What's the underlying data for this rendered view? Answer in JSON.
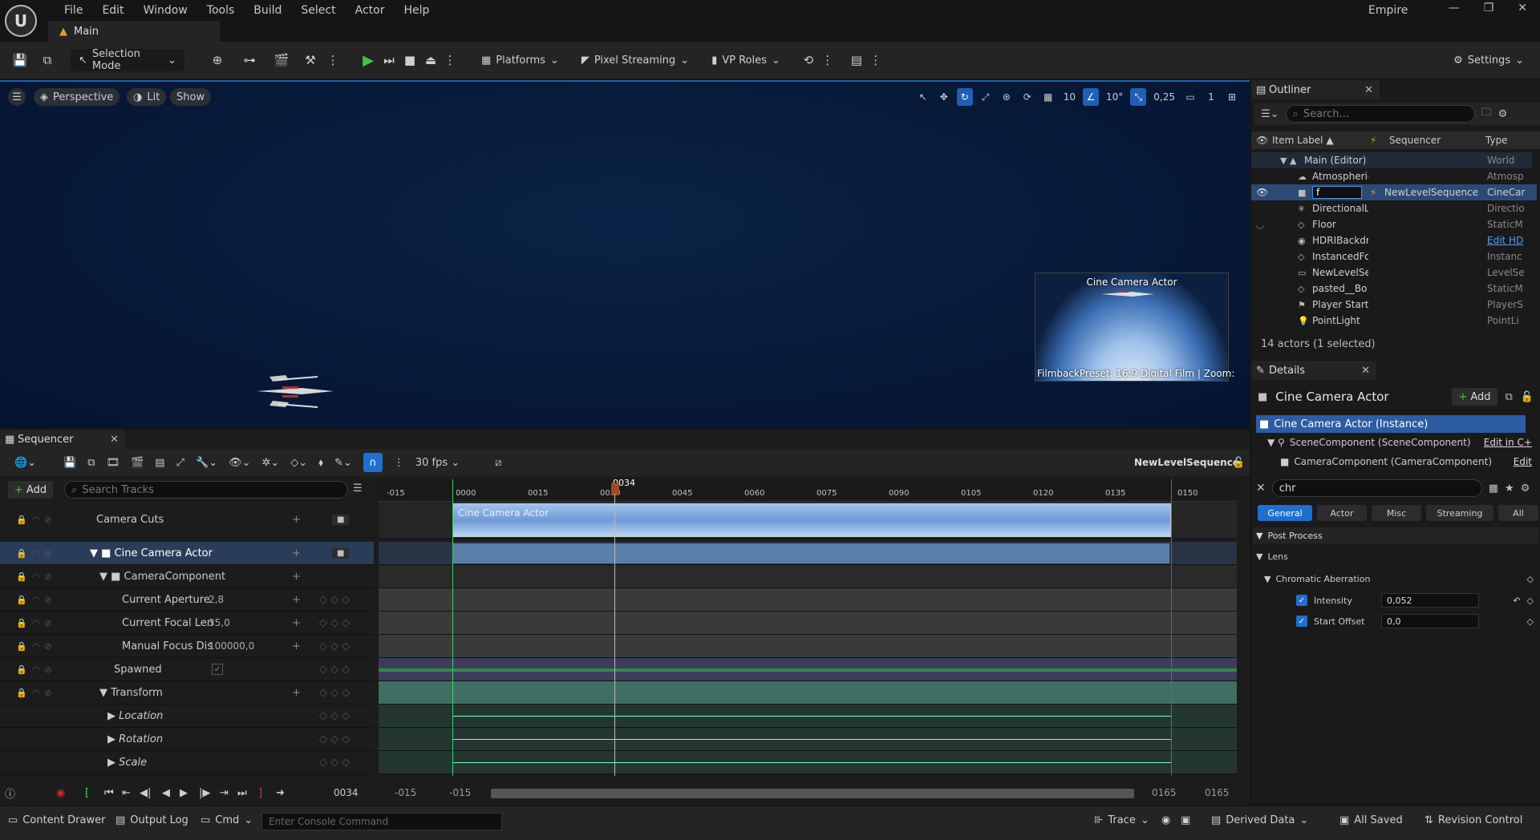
{
  "menu": [
    "File",
    "Edit",
    "Window",
    "Tools",
    "Build",
    "Select",
    "Actor",
    "Help"
  ],
  "doc_tab": "Main",
  "window_title": "Empire",
  "toolbar": {
    "selection_mode": "Selection Mode",
    "platforms": "Platforms",
    "pixel_streaming": "Pixel Streaming",
    "vp_roles": "VP Roles",
    "settings": "Settings"
  },
  "viewport": {
    "perspective": "Perspective",
    "lit": "Lit",
    "show": "Show",
    "grid": "10",
    "angle": "10°",
    "scale": "0,25",
    "camera_speed": "1",
    "preview_title": "Cine Camera Actor",
    "preview_info": "FilmbackPreset: 16:9 Digital Film | Zoom:"
  },
  "outliner": {
    "tab": "Outliner",
    "search_placeholder": "Search...",
    "col_label": "Item Label ▲",
    "col_seq": "Sequencer",
    "col_type": "Type",
    "rows": [
      {
        "label": "Main (Editor)",
        "seq": "",
        "type": "World"
      },
      {
        "label": "Atmospheric",
        "seq": "",
        "type": "Atmosp"
      },
      {
        "label": "f",
        "seq": "NewLevelSequence",
        "type": "CineCar"
      },
      {
        "label": "DirectionalL",
        "seq": "",
        "type": "Directio"
      },
      {
        "label": "Floor",
        "seq": "",
        "type": "StaticM"
      },
      {
        "label": "HDRIBackdr",
        "seq": "",
        "type": "Edit HD"
      },
      {
        "label": "InstancedFo",
        "seq": "",
        "type": "Instanc"
      },
      {
        "label": "NewLevelSe",
        "seq": "",
        "type": "LevelSe"
      },
      {
        "label": "pasted__Bo",
        "seq": "",
        "type": "StaticM"
      },
      {
        "label": "Player Start",
        "seq": "",
        "type": "PlayerS"
      },
      {
        "label": "PointLight",
        "seq": "",
        "type": "PointLi"
      }
    ],
    "footer": "14 actors (1 selected)"
  },
  "details": {
    "tab": "Details",
    "title": "Cine Camera Actor",
    "add": "Add",
    "components": [
      "Cine Camera Actor (Instance)",
      "SceneComponent (SceneComponent)",
      "CameraComponent (CameraComponent)"
    ],
    "edit_cpp": "Edit in C+",
    "edit": "Edit",
    "search": "chr",
    "filters": [
      "General",
      "Actor",
      "Misc",
      "Streaming",
      "All"
    ],
    "cat_post": "Post Process",
    "cat_lens": "Lens",
    "chromatic": "Chromatic Aberration",
    "intensity_label": "Intensity",
    "intensity_value": "0,052",
    "offset_label": "Start Offset",
    "offset_value": "0,0"
  },
  "sequencer": {
    "tab": "Sequencer",
    "fps": "30 fps",
    "add": "Add",
    "search_placeholder": "Search Tracks",
    "sequence_name": "NewLevelSequence",
    "current_frame": "0034",
    "ticks": [
      "-015",
      "0000",
      "0015",
      "0030",
      "0045",
      "0060",
      "0075",
      "0090",
      "0105",
      "0120",
      "0135",
      "0150"
    ],
    "tracks": [
      {
        "name": "Camera Cuts",
        "value": ""
      },
      {
        "name": "Cine Camera Actor",
        "value": ""
      },
      {
        "name": "CameraComponent",
        "value": ""
      },
      {
        "name": "Current Aperture",
        "value": "2,8"
      },
      {
        "name": "Current Focal Len",
        "value": "35,0"
      },
      {
        "name": "Manual Focus Dis",
        "value": "100000,0"
      },
      {
        "name": "Spawned",
        "value": ""
      },
      {
        "name": "Transform",
        "value": ""
      },
      {
        "name": "Location",
        "value": ""
      },
      {
        "name": "Rotation",
        "value": ""
      },
      {
        "name": "Scale",
        "value": ""
      }
    ],
    "clip_label": "Cine Camera Actor",
    "range_start_a": "-015",
    "range_start_b": "-015",
    "range_end_a": "0165",
    "range_end_b": "0165"
  },
  "bottombar": {
    "content_drawer": "Content Drawer",
    "output_log": "Output Log",
    "cmd": "Cmd",
    "console_placeholder": "Enter Console Command",
    "trace": "Trace",
    "derived_data": "Derived Data",
    "all_saved": "All Saved",
    "revision_control": "Revision Control"
  }
}
